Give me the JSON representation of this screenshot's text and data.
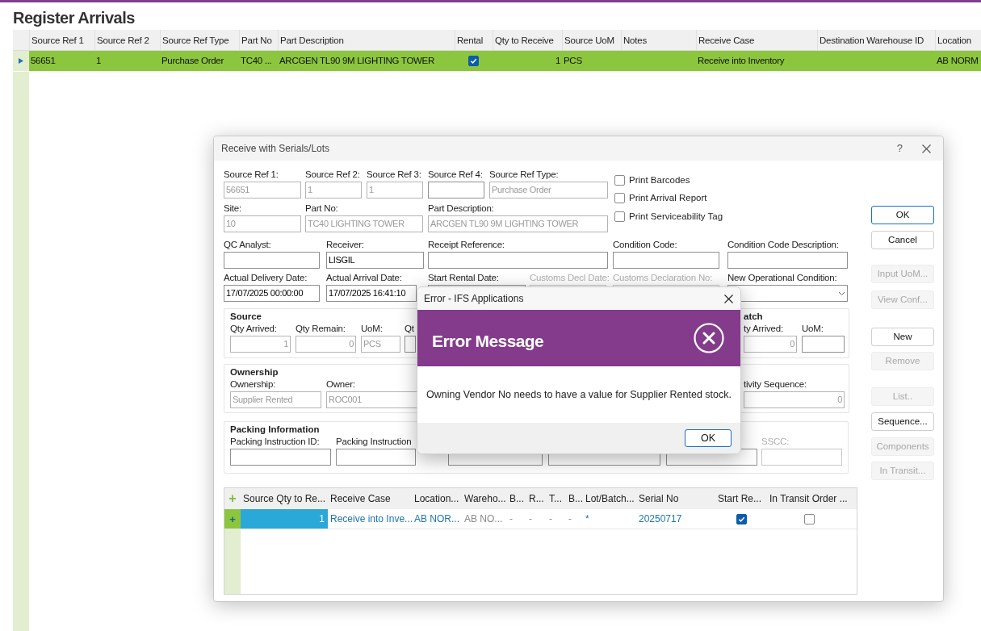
{
  "page": {
    "title": "Register Arrivals"
  },
  "grid": {
    "columns": [
      "Source Ref 1",
      "Source Ref 2",
      "Source Ref Type",
      "Part No",
      "Part Description",
      "Rental",
      "Qty to Receive",
      "Source UoM",
      "Notes",
      "Receive Case",
      "Destination Warehouse ID",
      "Location"
    ],
    "rows": [
      {
        "selected": true,
        "cells": [
          {
            "kind": "text",
            "value": "56651"
          },
          {
            "kind": "text",
            "value": "1"
          },
          {
            "kind": "text",
            "value": "Purchase Order"
          },
          {
            "kind": "text",
            "value": "TC40 ..."
          },
          {
            "kind": "text",
            "value": "ARCGEN TL90 9M LIGHTING TOWER"
          },
          {
            "kind": "checkbox",
            "checked": true
          },
          {
            "kind": "number",
            "value": "1"
          },
          {
            "kind": "text",
            "value": "PCS"
          },
          {
            "kind": "text"
          },
          {
            "kind": "text",
            "value": "Receive into Inventory"
          },
          {
            "kind": "text"
          },
          {
            "kind": "text",
            "value": "AB NORM"
          }
        ]
      }
    ]
  },
  "receive_dialog": {
    "title": "Receive with Serials/Lots",
    "help": "?",
    "field_rows": [
      {
        "fields": [
          {
            "kind": "text",
            "label": "Source Ref 1:",
            "value": "56651",
            "readonly": true,
            "disabled": false
          },
          {
            "kind": "text",
            "label": "Source Ref 2:",
            "value": "1",
            "readonly": true,
            "disabled": false
          },
          {
            "kind": "text",
            "label": "Source Ref 3:",
            "value": "1",
            "readonly": true,
            "disabled": false
          },
          {
            "kind": "text",
            "label": "Source Ref 4:",
            "readonly": false,
            "disabled": false
          },
          {
            "kind": "text",
            "label": "Source Ref Type:",
            "value": "Purchase Order",
            "readonly": true,
            "disabled": false
          }
        ]
      },
      {
        "fields": [
          {
            "kind": "text",
            "label": "Site:",
            "value": "10",
            "readonly": true,
            "disabled": false
          },
          {
            "kind": "text",
            "label": "Part No:",
            "value": "TC40 LIGHTING TOWER",
            "readonly": true,
            "disabled": false
          },
          {
            "kind": "text",
            "label": "Part Description:",
            "value": "ARCGEN TL90 9M LIGHTING TOWER",
            "readonly": true,
            "disabled": false
          }
        ]
      },
      {
        "fields": [
          {
            "kind": "text",
            "label": "QC Analyst:",
            "readonly": false,
            "disabled": false
          },
          {
            "kind": "text",
            "label": "Receiver:",
            "value": "LISGIL",
            "readonly": false,
            "disabled": false
          },
          {
            "kind": "text",
            "label": "Receipt Reference:",
            "readonly": false,
            "disabled": false
          },
          {
            "kind": "text",
            "label": "Condition Code:",
            "readonly": false,
            "disabled": false
          },
          {
            "kind": "text",
            "label": "Condition Code Description:",
            "readonly": false,
            "disabled": false
          }
        ]
      },
      {
        "fields": [
          {
            "kind": "text",
            "label": "Actual Delivery Date:",
            "value": "17/07/2025 00:00:00",
            "readonly": false,
            "disabled": false
          },
          {
            "kind": "text",
            "label": "Actual Arrival Date:",
            "value": "17/07/2025 16:41:10",
            "readonly": false,
            "disabled": false
          },
          {
            "kind": "text",
            "label": "Start Rental Date:",
            "readonly": false,
            "disabled": false
          },
          {
            "kind": "text",
            "label": "Customs Decl Date:",
            "readonly": false,
            "disabled": true
          },
          {
            "kind": "text",
            "label": "Customs Declaration No:",
            "readonly": false,
            "disabled": true
          },
          {
            "kind": "select",
            "label": "New Operational Condition:",
            "readonly": false,
            "disabled": false
          }
        ]
      }
    ],
    "print_options": [
      {
        "label": "Print Barcodes",
        "checked": false
      },
      {
        "label": "Print Arrival Report",
        "checked": false
      },
      {
        "label": "Print Serviceability Tag",
        "checked": false
      }
    ],
    "groups": [
      {
        "title": "Source",
        "fields": [
          {
            "kind": "number",
            "label": "Qty Arrived:",
            "value": "1",
            "readonly": true,
            "disabled": false
          },
          {
            "kind": "number",
            "label": "Qty Remain:",
            "value": "0",
            "readonly": true,
            "disabled": false
          },
          {
            "kind": "text",
            "label": "UoM:",
            "value": "PCS",
            "readonly": true,
            "disabled": false
          },
          {
            "kind": "text",
            "label": "Qt",
            "readonly": false,
            "disabled": false
          }
        ]
      },
      {
        "title": "atch",
        "fields": [
          {
            "kind": "number",
            "label": "ty Arrived:",
            "value": "0",
            "readonly": true,
            "disabled": false
          },
          {
            "kind": "text",
            "label": "UoM:",
            "readonly": false,
            "disabled": false
          }
        ]
      },
      {
        "title": "Ownership",
        "fields": [
          {
            "kind": "text",
            "label": "Ownership:",
            "value": "Supplier Rented",
            "readonly": true,
            "disabled": false
          },
          {
            "kind": "text",
            "label": "Owner:",
            "value": "ROC001",
            "readonly": true,
            "disabled": false
          }
        ]
      },
      {
        "fields": [
          {
            "kind": "number",
            "label": "tivity Sequence:",
            "value": "0",
            "readonly": true,
            "disabled": false
          }
        ]
      },
      {
        "title": "Packing Information",
        "fields": [
          {
            "kind": "text",
            "label": "Packing Instruction ID:",
            "readonly": false,
            "disabled": false
          },
          {
            "kind": "text",
            "label": "Packing Instruction",
            "readonly": false,
            "disabled": false
          },
          {
            "kind": "text",
            "readonly": false,
            "disabled": false
          },
          {
            "kind": "text",
            "readonly": false,
            "disabled": false
          },
          {
            "kind": "text",
            "readonly": false,
            "disabled": false
          },
          {
            "kind": "text",
            "label": "SSCC:",
            "readonly": false,
            "disabled": true
          }
        ]
      }
    ],
    "buttons": [
      {
        "label": "OK",
        "default": true,
        "disabled": false
      },
      {
        "label": "Cancel",
        "default": false,
        "disabled": false
      },
      {
        "label": "Input UoM...",
        "default": false,
        "disabled": true
      },
      {
        "label": "View Conf...",
        "default": false,
        "disabled": true
      },
      {
        "label": "New",
        "default": false,
        "disabled": false
      },
      {
        "label": "Remove",
        "default": false,
        "disabled": true
      },
      {
        "label": "List..",
        "default": false,
        "disabled": true
      },
      {
        "label": "Sequence...",
        "default": false,
        "disabled": false
      },
      {
        "label": "Components",
        "default": false,
        "disabled": true
      },
      {
        "label": "In Transit...",
        "default": false,
        "disabled": true
      }
    ],
    "lines": {
      "add": "+",
      "columns": [
        "Source Qty to Re...",
        "Receive Case",
        "Location...",
        "Wareho...",
        "B...",
        "R...",
        "T...",
        "B...",
        "Lot/Batch...",
        "Serial No",
        "Start Re...",
        "In Transit Order ..."
      ],
      "rows": [
        {
          "marker": "+",
          "cells": [
            {
              "kind": "qty",
              "value": "1"
            },
            {
              "kind": "link",
              "value": "Receive into Inve..."
            },
            {
              "kind": "link",
              "value": "AB NOR..."
            },
            {
              "kind": "muted",
              "value": "AB NO..."
            },
            {
              "kind": "muted",
              "value": "-"
            },
            {
              "kind": "muted",
              "value": "-"
            },
            {
              "kind": "muted",
              "value": "-"
            },
            {
              "kind": "muted",
              "value": "-"
            },
            {
              "kind": "link",
              "value": "*"
            },
            {
              "kind": "link",
              "value": "20250717"
            },
            {
              "kind": "checkbox",
              "checked": true
            },
            {
              "kind": "checkbox",
              "checked": false
            }
          ]
        }
      ]
    }
  },
  "error_dialog": {
    "title": "Error - IFS Applications",
    "heading": "Error Message",
    "message": "Owning Vendor No needs to have a value for Supplier Rented stock.",
    "button": "OK"
  }
}
